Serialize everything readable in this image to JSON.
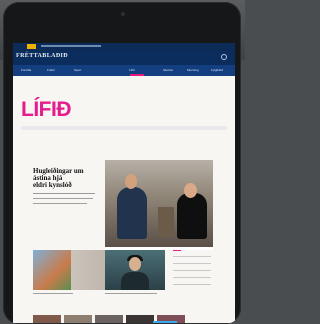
{
  "site": {
    "name": "FRÉTTABLAÐIÐ",
    "top_links": [
      "Forsíða",
      "Fréttir",
      "Skoðun",
      "Sport",
      "Lífið",
      "Fylgiblöð",
      "Menning",
      "Lífið"
    ]
  },
  "sections": {
    "items": [
      "Forsíða",
      "Fréttir",
      "Sport",
      "Lífið",
      "Skoðun",
      "Menning",
      "Fylgiblöð"
    ]
  },
  "page": {
    "section_title": "LÍFIÐ"
  },
  "headline": {
    "line1": "Hugleiðingar um",
    "line2": "ástina hjá",
    "line3": "eldri kynslóð"
  },
  "icons": {
    "search": "search-icon",
    "menu": "menu-icon"
  },
  "colors": {
    "brand_blue": "#0b2d5e",
    "accent_pink": "#e51c8d"
  }
}
